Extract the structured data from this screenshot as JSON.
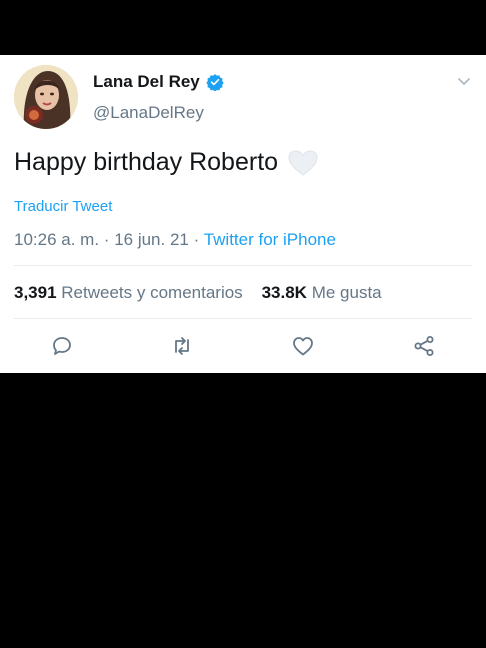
{
  "tweet": {
    "display_name": "Lana Del Rey",
    "handle": "@LanaDelRey",
    "text": "Happy birthday Roberto",
    "translate_label": "Traducir Tweet",
    "time": "10:26 a. m.",
    "date": "16 jun. 21",
    "source": "Twitter for iPhone",
    "retweets_count": "3,391",
    "retweets_label": "Retweets y comentarios",
    "likes_count": "33.8K",
    "likes_label": "Me gusta"
  },
  "icons": {
    "verified": "verified-badge-icon",
    "more": "chevron-down-icon",
    "emoji": "white-heart-emoji",
    "reply": "reply-icon",
    "retweet": "retweet-icon",
    "like": "heart-icon",
    "share": "share-icon"
  },
  "colors": {
    "accent": "#1da1f2",
    "text": "#14171a",
    "secondary": "#657786",
    "background": "#000000",
    "card": "#ffffff"
  }
}
